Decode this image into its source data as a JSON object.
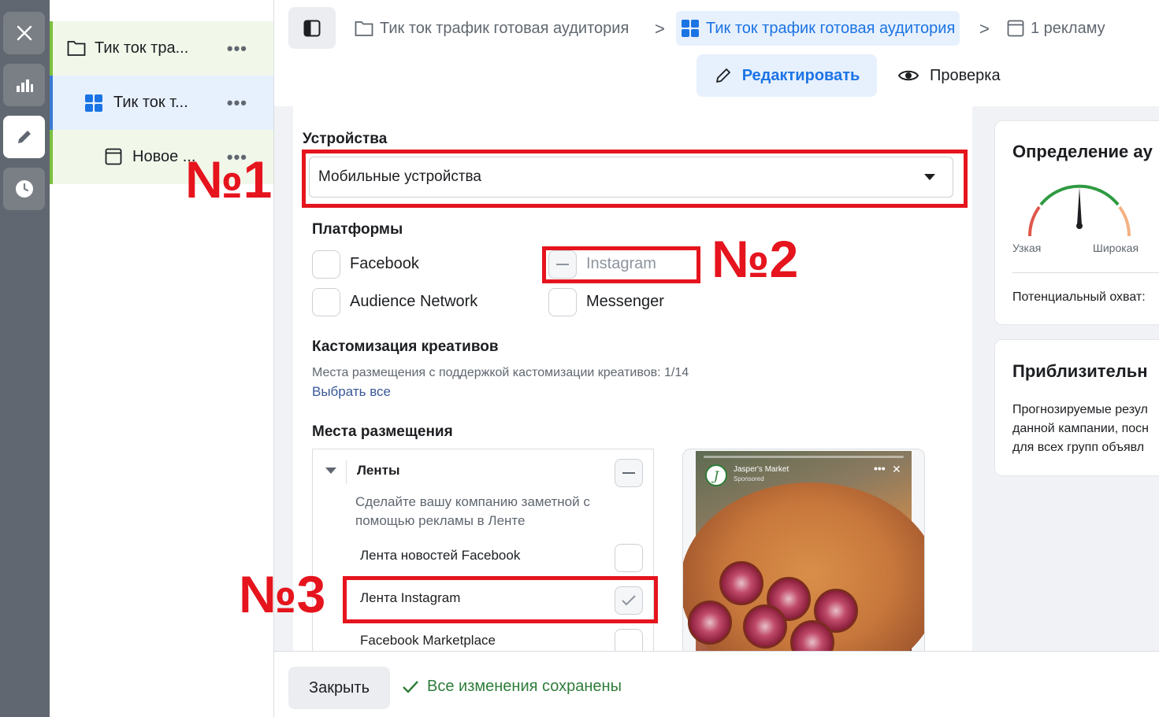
{
  "tree": {
    "items": [
      {
        "label": "Тик ток тра...",
        "dots": "•••"
      },
      {
        "label": "Тик ток т...",
        "dots": "•••"
      },
      {
        "label": "Новое ...",
        "dots": "•••"
      }
    ]
  },
  "breadcrumbs": [
    {
      "label": "Тик ток трафик готовая аудитория"
    },
    {
      "label": "Тик ток трафик готовая аудитория"
    },
    {
      "label": "1 рекламу"
    }
  ],
  "breadcrumb_separator": ">",
  "mode": {
    "edit_label": "Редактировать",
    "review_label": "Проверка"
  },
  "devices": {
    "label": "Устройства",
    "selected": "Мобильные устройства"
  },
  "platforms": {
    "label": "Платформы",
    "items": [
      {
        "label": "Facebook",
        "state": "unchecked"
      },
      {
        "label": "Instagram",
        "state": "indeterminate"
      },
      {
        "label": "Audience Network",
        "state": "unchecked"
      },
      {
        "label": "Messenger",
        "state": "unchecked"
      }
    ]
  },
  "customization": {
    "label": "Кастомизация креативов",
    "desc": "Места размещения с поддержкой кастомизации креативов: 1/14",
    "select_all": "Выбрать все"
  },
  "placements": {
    "label": "Места размещения",
    "group_title": "Ленты",
    "group_desc": "Сделайте вашу компанию заметной с помощью рекламы в Ленте",
    "items": [
      {
        "label": "Лента новостей Facebook",
        "state": "unchecked"
      },
      {
        "label": "Лента Instagram",
        "state": "checked"
      },
      {
        "label": "Facebook Marketplace",
        "state": "unchecked"
      }
    ]
  },
  "preview": {
    "name": "Jasper's Market",
    "sponsored": "Sponsored",
    "avatar_letter": "J",
    "more": "•••",
    "close": "✕"
  },
  "audience_card": {
    "title": "Определение ау",
    "narrow": "Узкая",
    "wide": "Широкая",
    "reach": "Потенциальный охват:",
    "gauge_level": 0.52
  },
  "estimate_card": {
    "title": "Приблизительн",
    "lines": [
      "Прогнозируемые резул",
      "данной кампании, посн",
      "для всех групп объявл"
    ]
  },
  "footer": {
    "close_label": "Закрыть",
    "saved_label": "Все изменения сохранены"
  },
  "annotations": {
    "n1": "№1",
    "n2": "№2",
    "n3": "№3"
  },
  "colors": {
    "accent": "#1b74e4",
    "annotation_red": "#e5141d",
    "success_green": "#2f7d3a",
    "tree_green": "#7cc040"
  }
}
